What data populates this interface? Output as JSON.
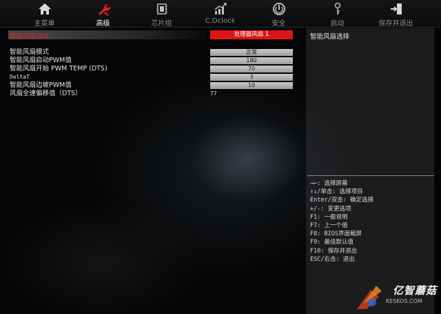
{
  "nav": {
    "items": [
      {
        "label": "主菜单",
        "icon": "home-icon"
      },
      {
        "label": "高级",
        "icon": "wrench-icon",
        "active": true
      },
      {
        "label": "芯片组",
        "icon": "chip-icon"
      },
      {
        "label": "C.Oclock",
        "icon": "chart-icon"
      },
      {
        "label": "安全",
        "icon": "power-shield-icon"
      },
      {
        "label": "启动",
        "icon": "key-icon"
      },
      {
        "label": "保存并退出",
        "icon": "exit-icon"
      }
    ]
  },
  "settings": {
    "header": {
      "label": "智能风扇选择",
      "value": "处理器风扇 1"
    },
    "rows": [
      {
        "label": "智能风扇模式",
        "value": "正常"
      },
      {
        "label": "智能风扇启动PWM值",
        "value": "180"
      },
      {
        "label": "智能风扇开始 PWM TEMP (DTS)",
        "value": "70"
      },
      {
        "label": "DeltaT",
        "value": "3"
      },
      {
        "label": "智能风扇边坡PWM值",
        "value": "10"
      },
      {
        "label": "风扇全速偏移值（DTS）",
        "value": "77"
      }
    ]
  },
  "help": {
    "title": "智能风扇选择",
    "lines": [
      "→←: 选择屏幕",
      "↑↓/单击: 选择项目",
      "Enter/双击: 确定选择",
      "+/-: 变更选项",
      "F1: 一般说明",
      "F7: 上一个值",
      "F8: BIOS界面截屏",
      "F9: 最佳默认值",
      "F10: 保存并退出",
      "ESC/右击: 退出"
    ]
  },
  "watermark": {
    "text": "亿智蘑菇",
    "sub": "KESKOS.COM"
  },
  "colors": {
    "accent": "#dc1616",
    "title_text": "#d9262a",
    "value_bg": "#b5b5b5"
  }
}
